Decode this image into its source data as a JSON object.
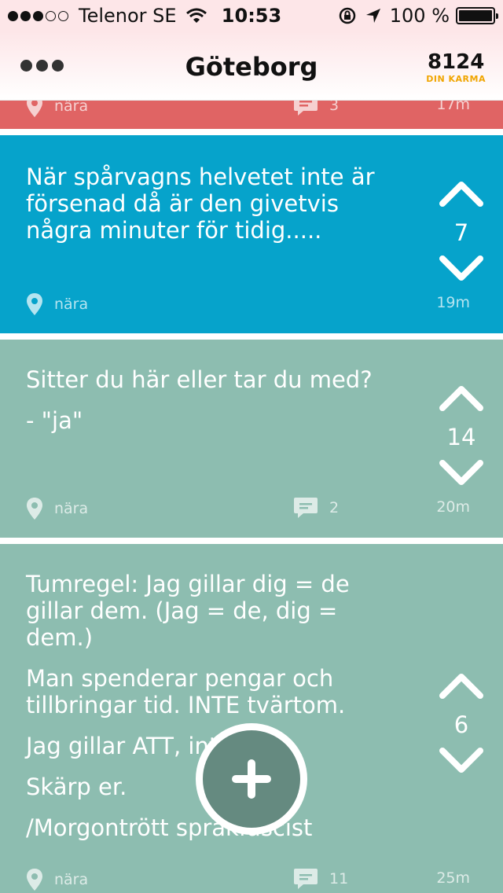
{
  "status_bar": {
    "carrier": "Telenor SE",
    "time": "10:53",
    "battery": "100 %"
  },
  "header": {
    "title": "Göteborg",
    "karma_value": "8124",
    "karma_label": "DIN KARMA"
  },
  "posts": [
    {
      "id": "partial",
      "location": "nära",
      "comments": "3",
      "time": "17m",
      "color": "#e06464"
    },
    {
      "id": "post1",
      "paragraphs": [
        "När spårvagns helvetet inte är försenad då är den givetvis några minuter för tidig....."
      ],
      "votes": "7",
      "location": "nära",
      "time": "19m",
      "color": "#06a3cb"
    },
    {
      "id": "post2",
      "paragraphs": [
        "Sitter du här eller tar du med?",
        "- \"ja\""
      ],
      "votes": "14",
      "location": "nära",
      "comments": "2",
      "time": "20m",
      "color": "#8dbdb0"
    },
    {
      "id": "post3",
      "paragraphs": [
        "Tumregel: Jag gillar dig = de gillar dem. (Jag = de, dig = dem.)",
        "Man spenderar pengar och tillbringar tid. INTE tvärtom.",
        "Jag gillar ATT, inte OCH.",
        "Skärp er.",
        "/Morgontrött språkfascist"
      ],
      "votes": "6",
      "location": "nära",
      "comments": "11",
      "time": "25m",
      "color": "#8dbdb0"
    }
  ],
  "icons": {
    "menu": "more-dots-icon",
    "location": "location-pin-icon",
    "comment": "comment-bubble-icon",
    "upvote": "chevron-up-icon",
    "downvote": "chevron-down-icon",
    "add": "plus-icon"
  }
}
